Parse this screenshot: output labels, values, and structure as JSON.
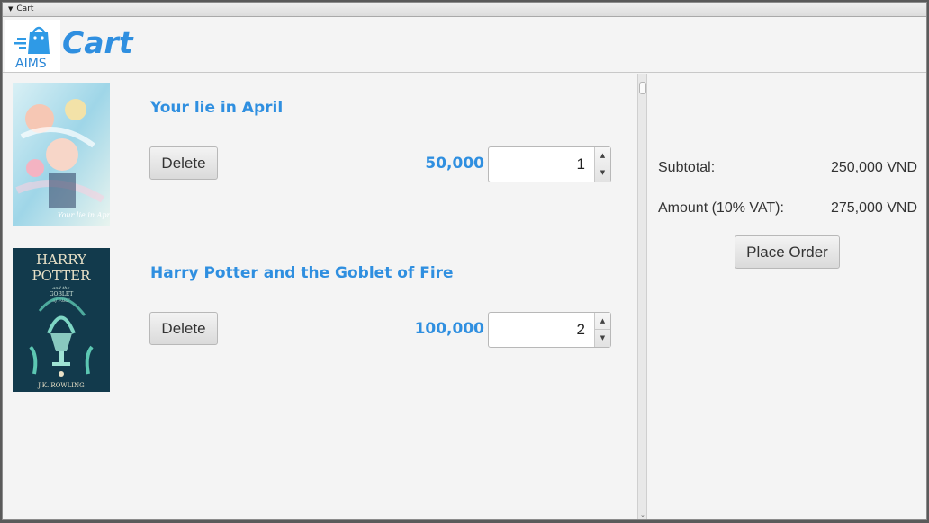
{
  "window": {
    "title": "Cart"
  },
  "header": {
    "logo_text": "AIMS",
    "title": "Cart"
  },
  "items": [
    {
      "title": "Your lie in April",
      "price": "50,000",
      "quantity": "1",
      "delete_label": "Delete",
      "cover_caption": "Your lie in April"
    },
    {
      "title": "Harry Potter and the Goblet of Fire",
      "price": "100,000",
      "quantity": "2",
      "delete_label": "Delete",
      "cover_line1": "HARRY",
      "cover_line2": "POTTER",
      "cover_sub1": "and the",
      "cover_sub2": "GOBLET",
      "cover_sub3": "of FIRE",
      "cover_author": "J.K. ROWLING"
    }
  ],
  "summary": {
    "subtotal_label": "Subtotal:",
    "subtotal_value": "250,000 VND",
    "amount_label": "Amount (10% VAT):",
    "amount_value": "275,000 VND",
    "place_order_label": "Place Order"
  },
  "colors": {
    "accent": "#2f8fe0"
  }
}
